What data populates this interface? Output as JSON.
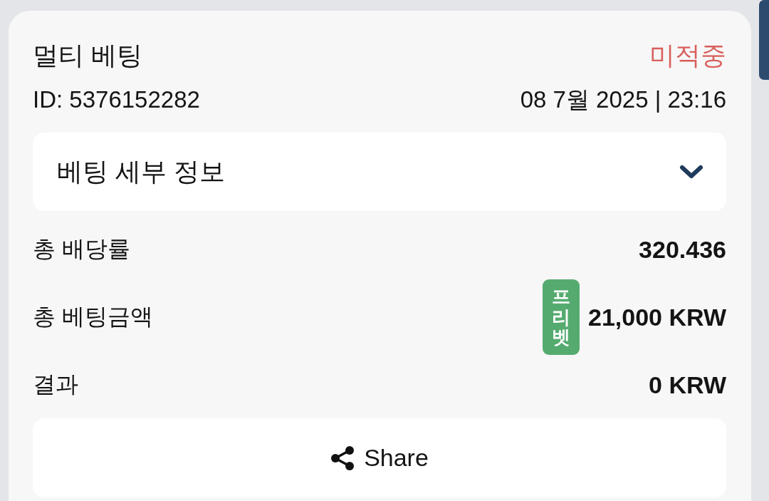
{
  "bet": {
    "title": "멀티 베팅",
    "status": {
      "label": "미적중",
      "kind": "lost"
    },
    "id": "ID: 5376152282",
    "datetime": "08 7월 2025 | 23:16",
    "details": {
      "label": "베팅 세부 정보",
      "expanded": false
    },
    "rows": [
      {
        "label": "총 배당률",
        "value": "320.436"
      },
      {
        "label": "총 베팅금액",
        "value": "21,000 KRW",
        "badge": "프리벳"
      },
      {
        "label": "결과",
        "value": "0 KRW"
      }
    ],
    "share_button": {
      "label": "Share"
    }
  }
}
